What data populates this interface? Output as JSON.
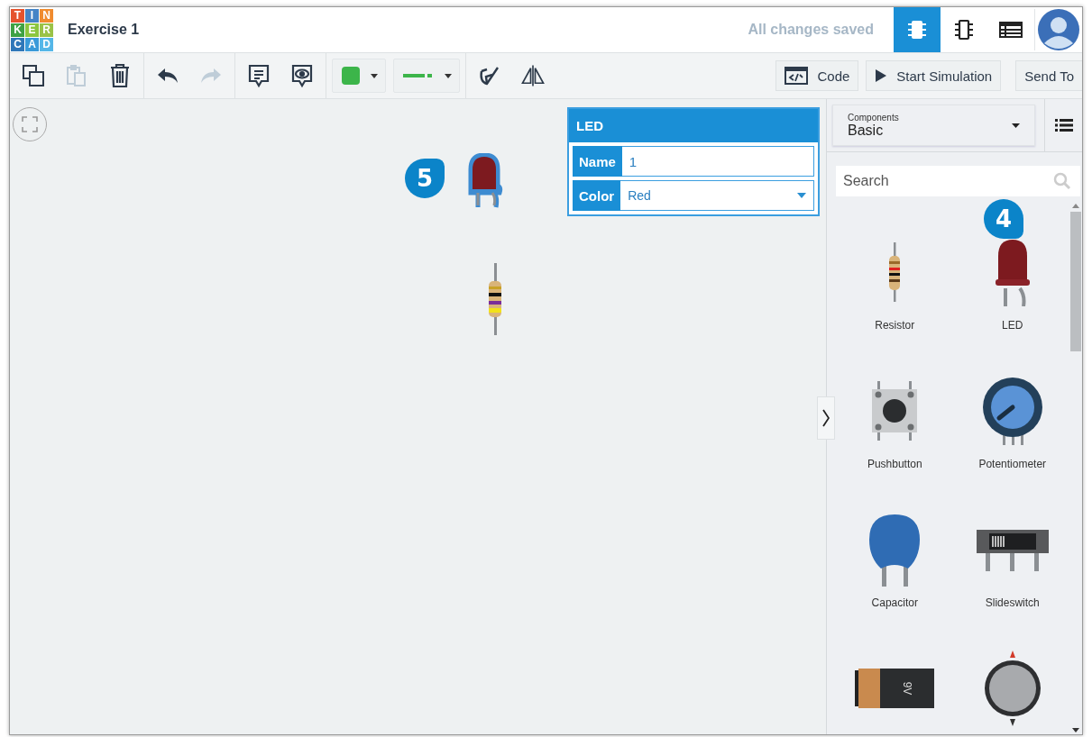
{
  "logo_letters": [
    "T",
    "I",
    "N",
    "K",
    "E",
    "R",
    "C",
    "A",
    "D"
  ],
  "title": "Exercise 1",
  "save_status": "All changes saved",
  "view_tabs": [
    {
      "kind": "circuit",
      "selected": true
    },
    {
      "kind": "schematic",
      "selected": false
    },
    {
      "kind": "list",
      "selected": false
    }
  ],
  "tool_groups": [
    [
      {
        "kind": "copy",
        "disabled": false
      },
      {
        "kind": "paste",
        "disabled": true
      },
      {
        "kind": "delete",
        "disabled": false
      }
    ],
    [
      {
        "kind": "undo",
        "disabled": false
      },
      {
        "kind": "redo",
        "disabled": true
      }
    ],
    [
      {
        "kind": "note",
        "disabled": false
      },
      {
        "kind": "note-visibility",
        "disabled": false
      }
    ]
  ],
  "wire_color": {
    "color": "#3cb54a"
  },
  "extra_tools": [
    {
      "kind": "rotate",
      "disabled": false
    },
    {
      "kind": "mirror",
      "disabled": false
    }
  ],
  "action_buttons": [
    {
      "kind": "code",
      "label": "Code"
    },
    {
      "kind": "simulate",
      "label": "Start Simulation"
    },
    {
      "kind": "send",
      "label": "Send To"
    }
  ],
  "canvas_parts": [
    {
      "kind": "led",
      "selected": true
    },
    {
      "kind": "resistor",
      "selected": false
    }
  ],
  "inspector": {
    "title": "LED",
    "fields": [
      {
        "kind": "text",
        "label": "Name",
        "value": "1"
      },
      {
        "kind": "select",
        "label": "Color",
        "value": "Red"
      }
    ]
  },
  "components": {
    "label": "Components",
    "value": "Basic",
    "search_placeholder": "Search",
    "items": [
      {
        "kind": "resistor",
        "label": "Resistor"
      },
      {
        "kind": "led",
        "label": "LED"
      },
      {
        "kind": "pushbutton",
        "label": "Pushbutton"
      },
      {
        "kind": "potentiometer",
        "label": "Potentiometer"
      },
      {
        "kind": "capacitor",
        "label": "Capacitor"
      },
      {
        "kind": "slideswitch",
        "label": "Slideswitch"
      },
      {
        "kind": "battery",
        "marking": "9V"
      },
      {
        "kind": "coin-cell"
      }
    ]
  },
  "callouts": [
    {
      "number": "5"
    },
    {
      "number": "4"
    }
  ]
}
